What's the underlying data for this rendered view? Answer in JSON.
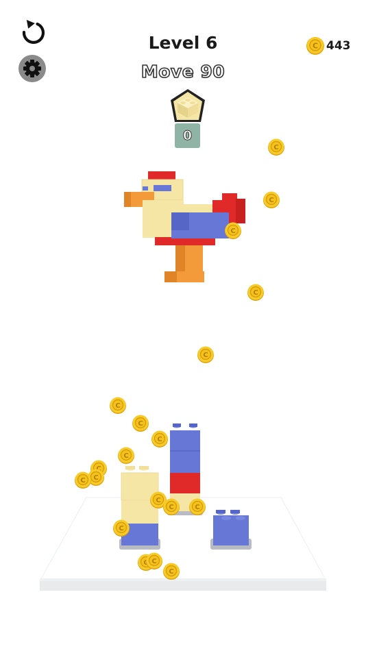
{
  "hud": {
    "level_title": "Level 6",
    "move_label": "Move 90",
    "coins": "443",
    "target_count": "0",
    "restart_icon": "restart-icon",
    "settings_icon": "gear-icon"
  },
  "colors": {
    "brick_yellow": "#f5e6a6",
    "brick_blue": "#6677d6",
    "brick_red": "#e02a2a",
    "brick_orange": "#f39a3b",
    "coin_gold": "#f4c21a",
    "board": "#ffffff"
  },
  "stacks": [
    {
      "name": "yellow-blue-stack",
      "layers": [
        "blue",
        "yellow",
        "yellow"
      ]
    },
    {
      "name": "blue-red-stack",
      "layers": [
        "yellow",
        "red",
        "blue",
        "blue"
      ]
    },
    {
      "name": "blue-single-stack",
      "layers": [
        "blue"
      ]
    }
  ]
}
